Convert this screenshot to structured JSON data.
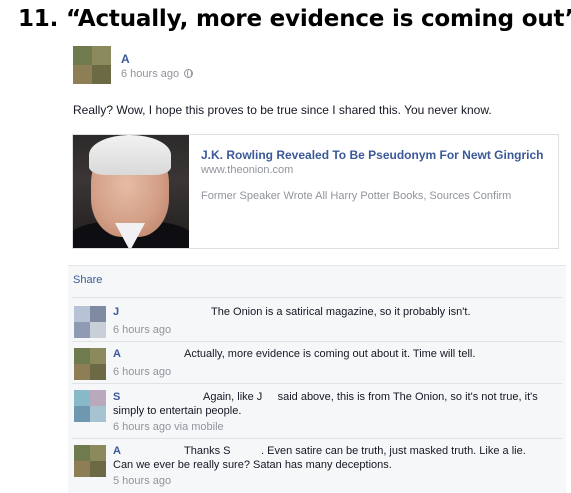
{
  "headline": "11. “Actually, more evidence is coming out”",
  "post": {
    "author": "A",
    "time": "6 hours ago",
    "text": "Really? Wow, I hope this proves to be true since I shared this. You never know.",
    "link": {
      "title": "J.K. Rowling Revealed To Be Pseudonym For Newt Gingrich",
      "domain": "www.theonion.com",
      "description": "Former Speaker Wrote All Harry Potter Books, Sources Confirm"
    }
  },
  "actions": {
    "share_label": "Share"
  },
  "comments": [
    {
      "author": "J",
      "text": "The Onion is a satirical magazine, so it probably isn't.",
      "time": "6 hours ago"
    },
    {
      "author": "A",
      "text": "Actually, more evidence is coming out about it. Time will tell.",
      "time": "6 hours ago"
    },
    {
      "author": "S",
      "text_line1": "Again, like J     said above, this is from The Onion, so it's not true, it's",
      "text_line2": "simply to entertain people.",
      "time": "6 hours ago via mobile"
    },
    {
      "author": "A",
      "text_line1": "Thanks S          . Even satire can be truth, just masked truth. Like a lie.",
      "text_line2": "Can we ever be really sure? Satan has many deceptions.",
      "time": "5 hours ago"
    }
  ],
  "colors": {
    "link_blue": "#3b5998",
    "meta_gray": "#90949c",
    "comment_bg": "#f6f7f9"
  }
}
